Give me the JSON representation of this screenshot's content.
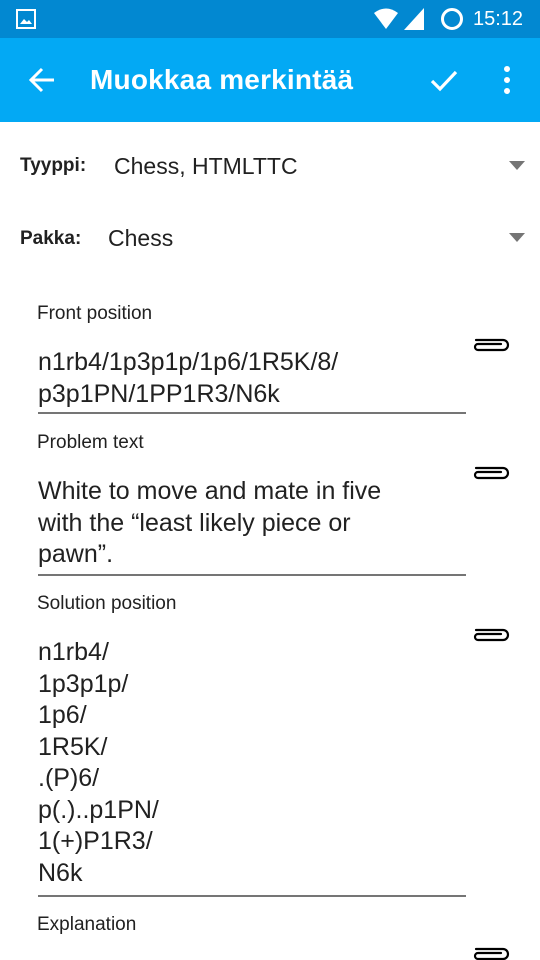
{
  "status_bar": {
    "time": "15:12",
    "icons": [
      "image-notification-icon",
      "wifi-icon",
      "cellular-signal-icon",
      "battery-ring-icon"
    ]
  },
  "app_bar": {
    "title": "Muokkaa merkintää",
    "icons": [
      "back-arrow-icon",
      "checkmark-icon",
      "overflow-menu-icon"
    ],
    "color": "#03a9f4",
    "status_color": "#0288d1"
  },
  "type_row": {
    "label": "Tyyppi:",
    "value": "Chess, HTMLTTC"
  },
  "deck_row": {
    "label": "Pakka:",
    "value": "Chess"
  },
  "fields": [
    {
      "label": "Front position",
      "value": "n1rb4/1p3p1p/1p6/1R5K/8/\np3p1PN/1PP1R3/N6k"
    },
    {
      "label": "Problem text",
      "value": "White to move and mate in five\nwith the “least likely piece or\npawn”."
    },
    {
      "label": "Solution position",
      "value": "n1rb4/\n1p3p1p/\n1p6/\n1R5K/\n.(P)6/\np(.)..p1PN/\n1(+)P1R3/\nN6k"
    },
    {
      "label": "Explanation",
      "value": ""
    }
  ]
}
